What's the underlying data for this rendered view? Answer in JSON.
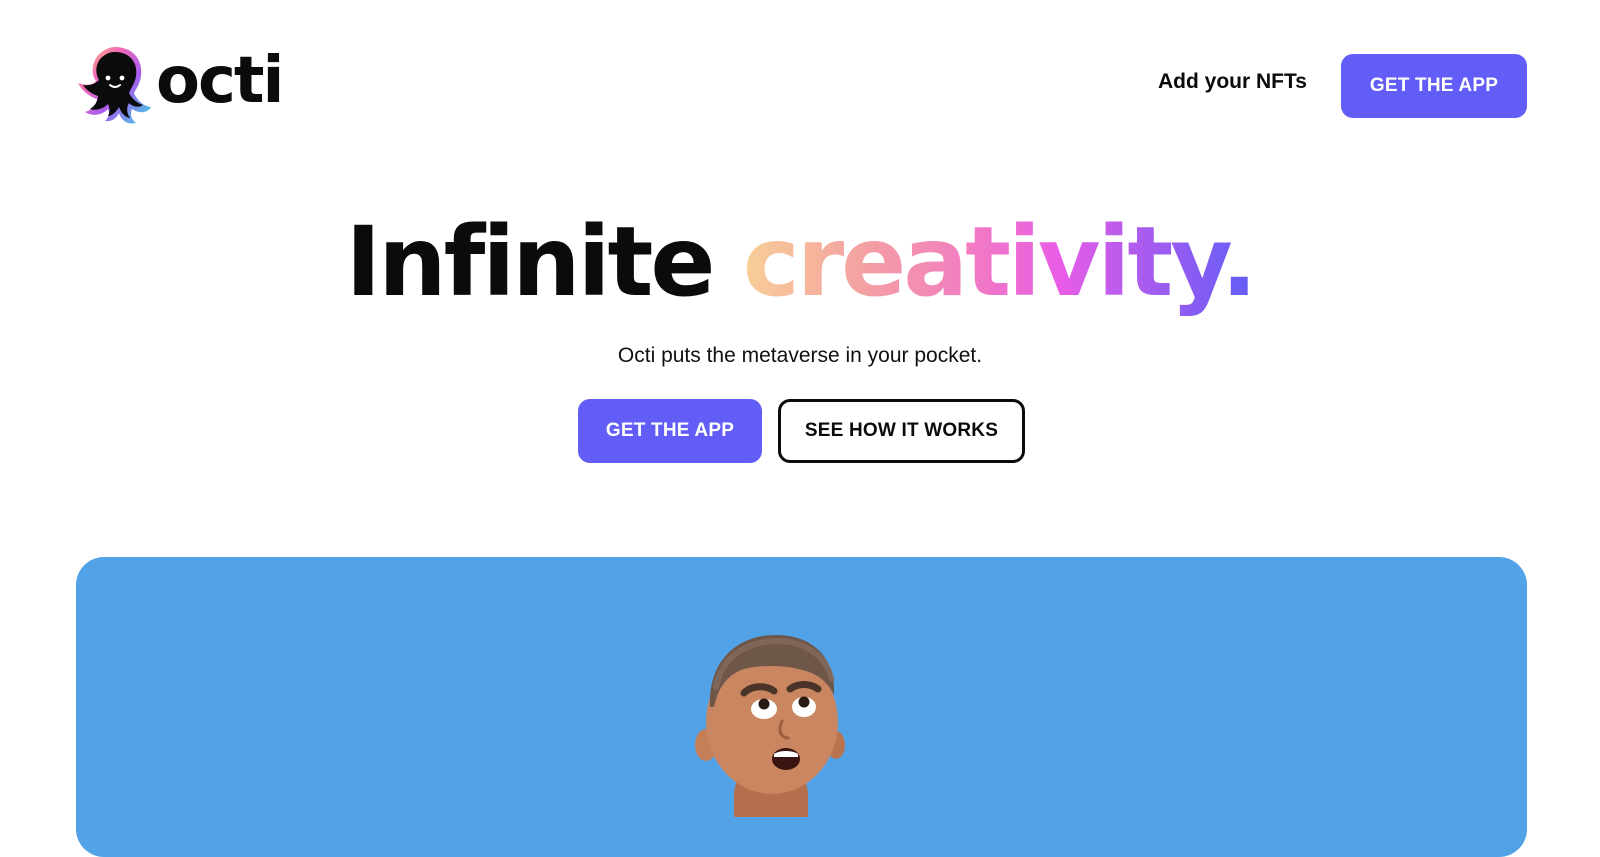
{
  "brand": {
    "name": "octi",
    "logo_icon": "octopus-logo-icon"
  },
  "nav": {
    "add_nfts": "Add your NFTs",
    "get_app": "GET THE APP"
  },
  "hero": {
    "title_plain": "Infinite",
    "title_gradient": "creativity.",
    "subtitle": "Octi puts the metaverse in your pocket.",
    "primary_cta": "GET THE APP",
    "secondary_cta": "SEE HOW IT WORKS"
  },
  "showcase": {
    "image": "avatar-character-illustration",
    "background_color": "#52a2e8"
  },
  "colors": {
    "accent": "#615df6",
    "text": "#0b0b0b",
    "background": "#ffffff"
  }
}
